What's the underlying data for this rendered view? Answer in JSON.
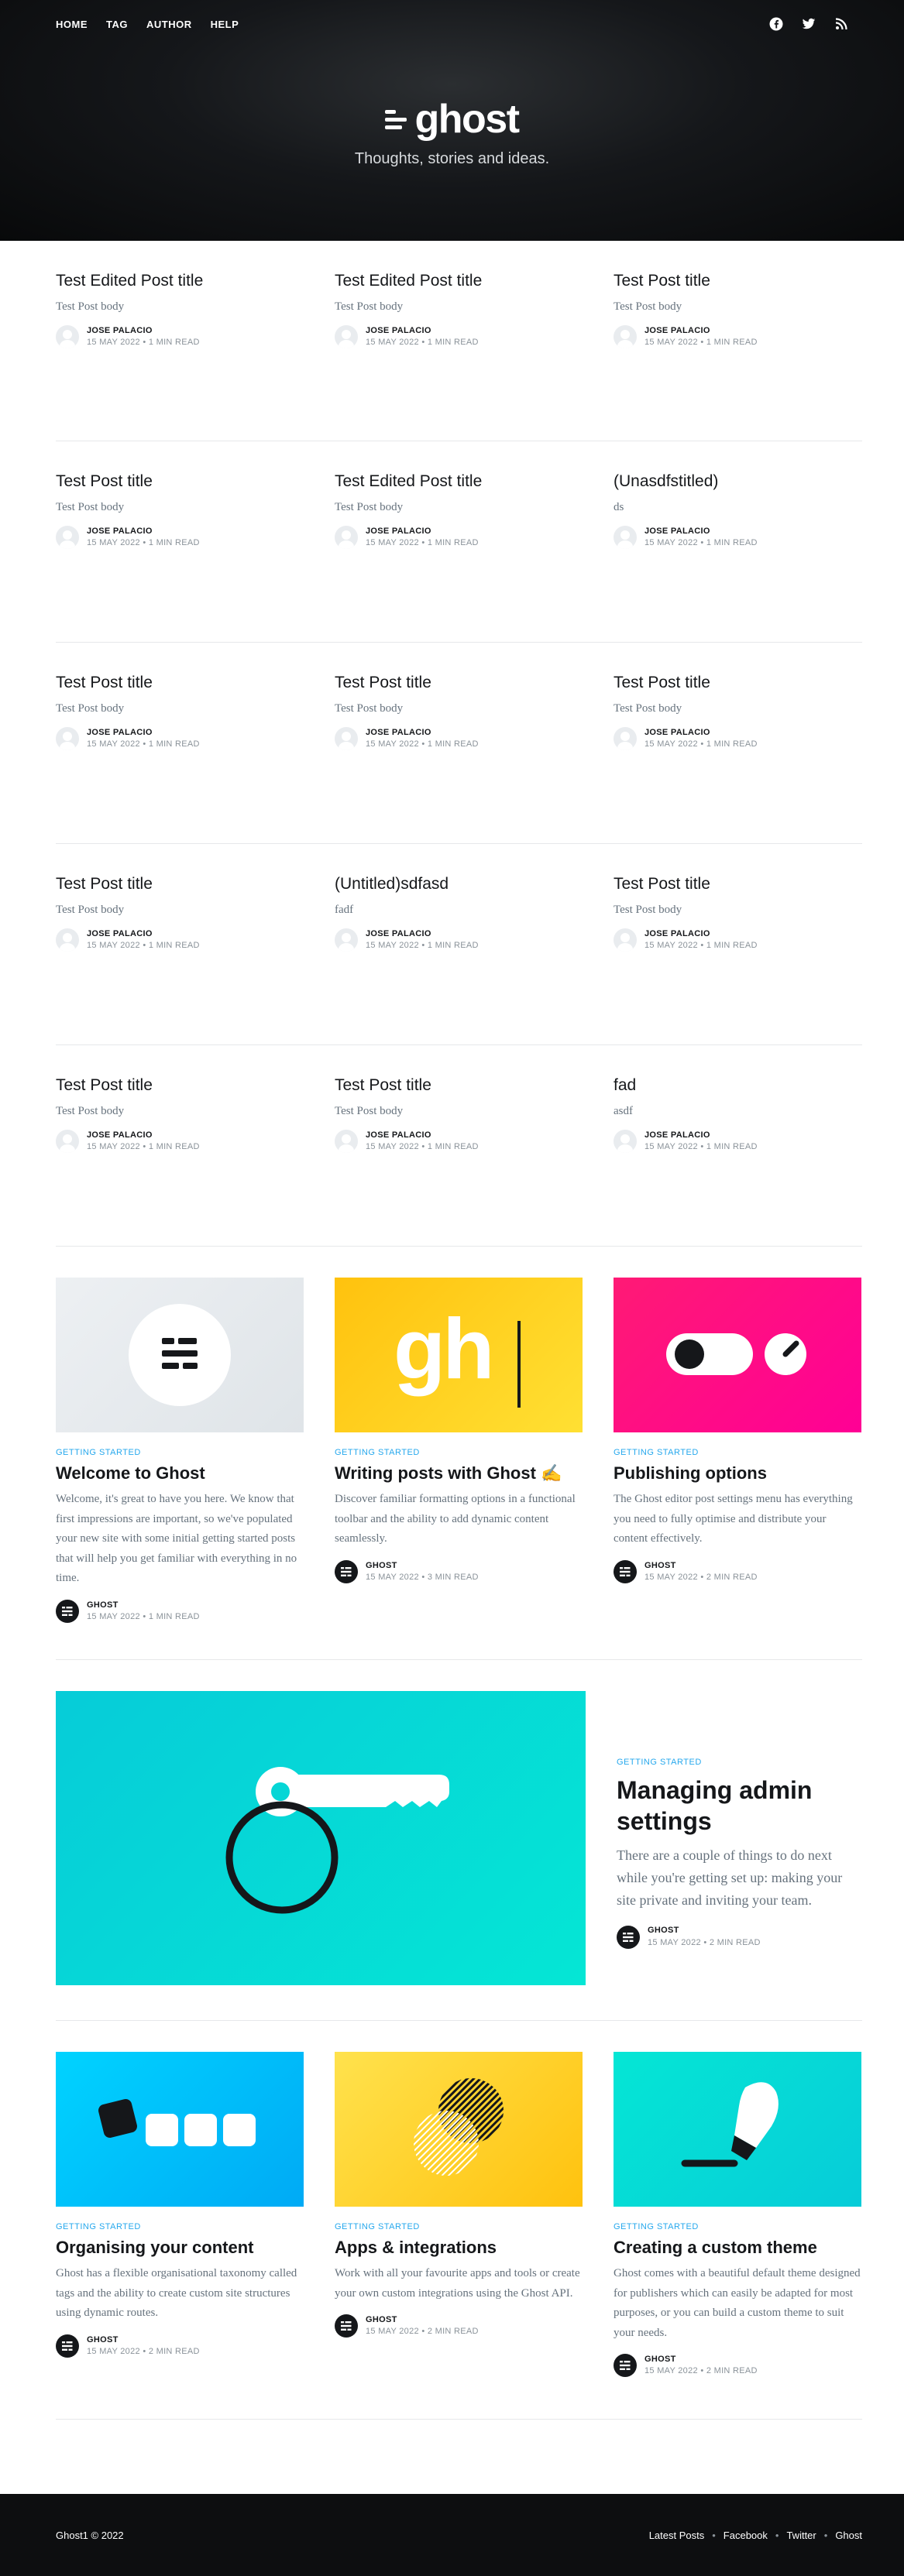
{
  "nav": {
    "items": [
      "HOME",
      "TAG",
      "AUTHOR",
      "HELP"
    ]
  },
  "social": {
    "icons": [
      "facebook-icon",
      "twitter-icon",
      "rss-icon"
    ]
  },
  "site": {
    "logo_text": "ghost",
    "tagline": "Thoughts, stories and ideas."
  },
  "posts": [
    {
      "title": "Test Edited Post title",
      "excerpt": "Test Post body",
      "author": "JOSE PALACIO",
      "date": "15 MAY 2022",
      "read": "1 MIN READ"
    },
    {
      "title": "Test Edited Post title",
      "excerpt": "Test Post body",
      "author": "JOSE PALACIO",
      "date": "15 MAY 2022",
      "read": "1 MIN READ"
    },
    {
      "title": "Test Post title",
      "excerpt": "Test Post body",
      "author": "JOSE PALACIO",
      "date": "15 MAY 2022",
      "read": "1 MIN READ"
    },
    {
      "title": "Test Post title",
      "excerpt": "Test Post body",
      "author": "JOSE PALACIO",
      "date": "15 MAY 2022",
      "read": "1 MIN READ"
    },
    {
      "title": "Test Edited Post title",
      "excerpt": "Test Post body",
      "author": "JOSE PALACIO",
      "date": "15 MAY 2022",
      "read": "1 MIN READ"
    },
    {
      "title": "(Unasdfstitled)",
      "excerpt": "ds",
      "author": "JOSE PALACIO",
      "date": "15 MAY 2022",
      "read": "1 MIN READ"
    },
    {
      "title": "Test Post title",
      "excerpt": "Test Post body",
      "author": "JOSE PALACIO",
      "date": "15 MAY 2022",
      "read": "1 MIN READ"
    },
    {
      "title": "Test Post title",
      "excerpt": "Test Post body",
      "author": "JOSE PALACIO",
      "date": "15 MAY 2022",
      "read": "1 MIN READ"
    },
    {
      "title": "Test Post title",
      "excerpt": "Test Post body",
      "author": "JOSE PALACIO",
      "date": "15 MAY 2022",
      "read": "1 MIN READ"
    },
    {
      "title": "Test Post title",
      "excerpt": "Test Post body",
      "author": "JOSE PALACIO",
      "date": "15 MAY 2022",
      "read": "1 MIN READ"
    },
    {
      "title": "(Untitled)sdfasd",
      "excerpt": "fadf",
      "author": "JOSE PALACIO",
      "date": "15 MAY 2022",
      "read": "1 MIN READ"
    },
    {
      "title": "Test Post title",
      "excerpt": "Test Post body",
      "author": "JOSE PALACIO",
      "date": "15 MAY 2022",
      "read": "1 MIN READ"
    },
    {
      "title": "Test Post title",
      "excerpt": "Test Post body",
      "author": "JOSE PALACIO",
      "date": "15 MAY 2022",
      "read": "1 MIN READ"
    },
    {
      "title": "Test Post title",
      "excerpt": "Test Post body",
      "author": "JOSE PALACIO",
      "date": "15 MAY 2022",
      "read": "1 MIN READ"
    },
    {
      "title": "fad",
      "excerpt": "asdf",
      "author": "JOSE PALACIO",
      "date": "15 MAY 2022",
      "read": "1 MIN READ"
    }
  ],
  "featured": [
    {
      "tag": "GETTING STARTED",
      "title": "Welcome to Ghost",
      "excerpt": "Welcome, it's great to have you here. We know that first impressions are important, so we've populated your new site with some initial getting started posts that will help you get familiar with everything in no time.",
      "author": "GHOST",
      "date": "15 MAY 2022",
      "read": "1 MIN READ"
    },
    {
      "tag": "GETTING STARTED",
      "title": "Writing posts with Ghost ✍️",
      "excerpt": "Discover familiar formatting options in a functional toolbar and the ability to add dynamic content seamlessly.",
      "author": "GHOST",
      "date": "15 MAY 2022",
      "read": "3 MIN READ",
      "image_text": "gh"
    },
    {
      "tag": "GETTING STARTED",
      "title": "Publishing options",
      "excerpt": "The Ghost editor post settings menu has everything you need to fully optimise and distribute your content effectively.",
      "author": "GHOST",
      "date": "15 MAY 2022",
      "read": "2 MIN READ"
    }
  ],
  "big": {
    "tag": "GETTING STARTED",
    "title": "Managing admin settings",
    "excerpt": "There are a couple of things to do next while you're getting set up: making your site private and inviting your team.",
    "author": "GHOST",
    "date": "15 MAY 2022",
    "read": "2 MIN READ"
  },
  "more": [
    {
      "tag": "GETTING STARTED",
      "title": "Organising your content",
      "excerpt": "Ghost has a flexible organisational taxonomy called tags and the ability to create custom site structures using dynamic routes.",
      "author": "GHOST",
      "date": "15 MAY 2022",
      "read": "2 MIN READ"
    },
    {
      "tag": "GETTING STARTED",
      "title": "Apps & integrations",
      "excerpt": "Work with all your favourite apps and tools or create your own custom integrations using the Ghost API.",
      "author": "GHOST",
      "date": "15 MAY 2022",
      "read": "2 MIN READ"
    },
    {
      "tag": "GETTING STARTED",
      "title": "Creating a custom theme",
      "excerpt": "Ghost comes with a beautiful default theme designed for publishers which can easily be adapted for most purposes, or you can build a custom theme to suit your needs.",
      "author": "GHOST",
      "date": "15 MAY 2022",
      "read": "2 MIN READ"
    }
  ],
  "separator": "•",
  "footer": {
    "copyright": "Ghost1 © 2022",
    "links": [
      "Latest Posts",
      "Facebook",
      "Twitter",
      "Ghost"
    ]
  },
  "colors": {
    "accent": "#26a8ed",
    "header_bg": "#15171a"
  }
}
